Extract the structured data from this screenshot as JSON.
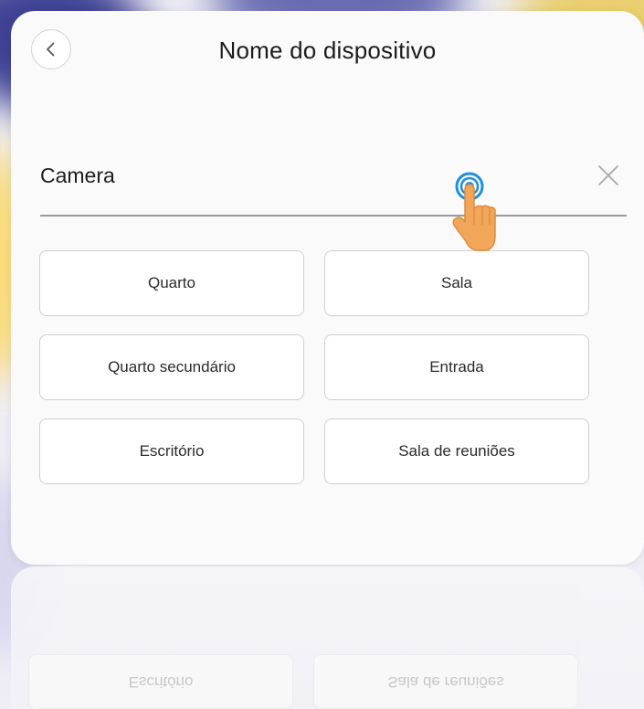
{
  "header": {
    "title": "Nome do dispositivo"
  },
  "name_field": {
    "value": "Camera"
  },
  "room_presets": [
    "Quarto",
    "Sala",
    "Quarto secundário",
    "Entrada",
    "Escritório",
    "Sala de reuniões"
  ],
  "reflection": {
    "left": "Escritório",
    "right": "Sala de reuniões"
  },
  "colors": {
    "card_background": "#fafafa",
    "tap_hint_ring": "#1e8fe0",
    "hand": "#f2a65a"
  },
  "icons": {
    "back": "chevron-left-icon",
    "clear": "close-icon",
    "tap_hint": "pointing-hand-icon"
  }
}
